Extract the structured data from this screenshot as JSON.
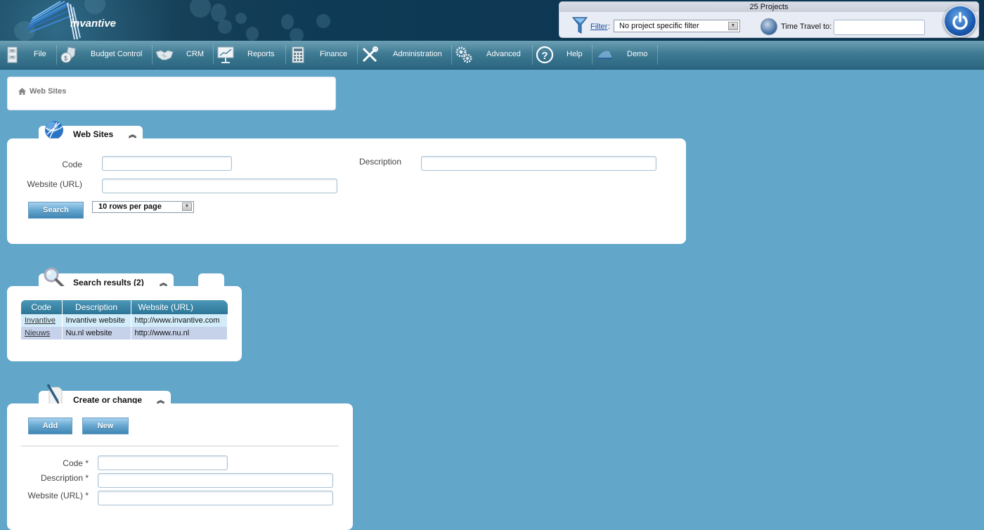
{
  "header": {
    "logo_text": "invantive",
    "project_count": "25 Projects",
    "filter_link": "Filter",
    "filter_colon": ":",
    "filter_select_value": "No project specific filter",
    "time_travel_label": "Time Travel to:",
    "time_travel_value": ""
  },
  "menu": {
    "items": [
      {
        "label": "File",
        "icon": "file-cabinet-icon"
      },
      {
        "label": "Budget Control",
        "icon": "money-bag-shield-icon"
      },
      {
        "label": "CRM",
        "icon": "handshake-icon"
      },
      {
        "label": "Reports",
        "icon": "presentation-chart-icon"
      },
      {
        "label": "Finance",
        "icon": "calculator-icon"
      },
      {
        "label": "Administration",
        "icon": "tools-icon"
      },
      {
        "label": "Advanced",
        "icon": "gears-icon"
      },
      {
        "label": "Help",
        "icon": "question-icon"
      },
      {
        "label": "Demo",
        "icon": "demo-logo-icon"
      }
    ]
  },
  "breadcrumb": {
    "current": "Web Sites"
  },
  "search_panel": {
    "title": "Web Sites",
    "code_label": "Code",
    "code_value": "",
    "description_label": "Description",
    "description_value": "",
    "url_label": "Website (URL)",
    "url_value": "",
    "search_button": "Search",
    "rows_per_page": "10 rows per page"
  },
  "results_panel": {
    "title": "Search results (2)",
    "columns": [
      "Code",
      "Description",
      "Website (URL)"
    ],
    "rows": [
      {
        "code": "Invantive",
        "description": "Invantive website",
        "url": "http://www.invantive.com"
      },
      {
        "code": "Nieuws",
        "description": "Nu.nl website",
        "url": "http://www.nu.nl"
      }
    ]
  },
  "edit_panel": {
    "title": "Create or change",
    "add_button": "Add",
    "new_button": "New",
    "code_label": "Code *",
    "code_value": "",
    "description_label": "Description *",
    "description_value": "",
    "url_label": "Website (URL) *",
    "url_value": ""
  },
  "colors": {
    "background": "#62a7c9",
    "header_dark": "#0e3a55",
    "menu_bar": "#3f7a93",
    "table_header": "#2c7596",
    "row_even": "#d3ecfa",
    "row_odd": "#c5d2ea"
  }
}
